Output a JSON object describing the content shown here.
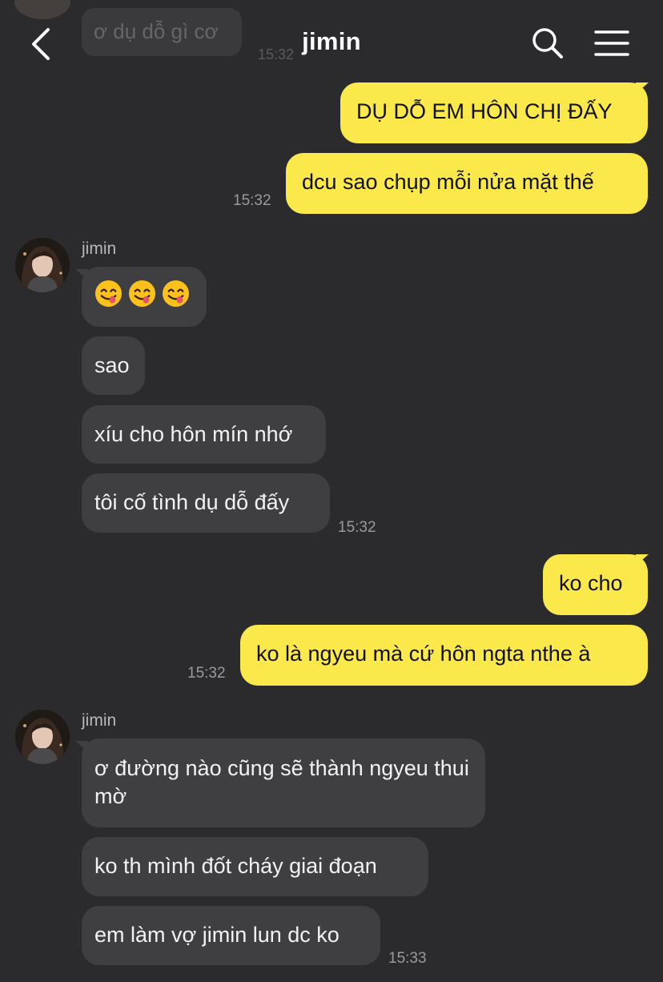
{
  "header": {
    "title": "jimin",
    "back_icon": "chevron-left-icon",
    "search_icon": "search-icon",
    "menu_icon": "hamburger-menu-icon"
  },
  "ghost": {
    "text": "ơ dụ dỗ gì cơ",
    "time": "15:32"
  },
  "colors": {
    "background": "#2b2b2d",
    "my_bubble": "#fbe94b",
    "their_bubble": "#3f3f41",
    "timestamp": "#9a9a9c"
  },
  "messages": [
    {
      "from": "me",
      "text": "DỤ DỖ EM HÔN CHỊ ĐẤY"
    },
    {
      "from": "me",
      "text": "dcu sao chụp mỗi nửa mặt thế",
      "time": "15:32"
    },
    {
      "from": "them",
      "sender": "jimin",
      "emoji": [
        "face-savoring-food",
        "face-savoring-food",
        "face-savoring-food"
      ]
    },
    {
      "from": "them",
      "text": "sao"
    },
    {
      "from": "them",
      "text": "xíu cho hôn mín nhớ"
    },
    {
      "from": "them",
      "text": "tôi cố tình dụ dỗ đấy",
      "time": "15:32"
    },
    {
      "from": "me",
      "text": "ko cho"
    },
    {
      "from": "me",
      "text": "ko là ngyeu mà cứ hôn ngta nthe à",
      "time": "15:32"
    },
    {
      "from": "them",
      "sender": "jimin",
      "text": "ơ đường nào cũng sẽ thành ngyeu thui mờ"
    },
    {
      "from": "them",
      "text": "ko th mình đốt cháy giai đoạn"
    },
    {
      "from": "them",
      "text": "em làm vợ jimin lun dc ko",
      "time": "15:33"
    }
  ]
}
